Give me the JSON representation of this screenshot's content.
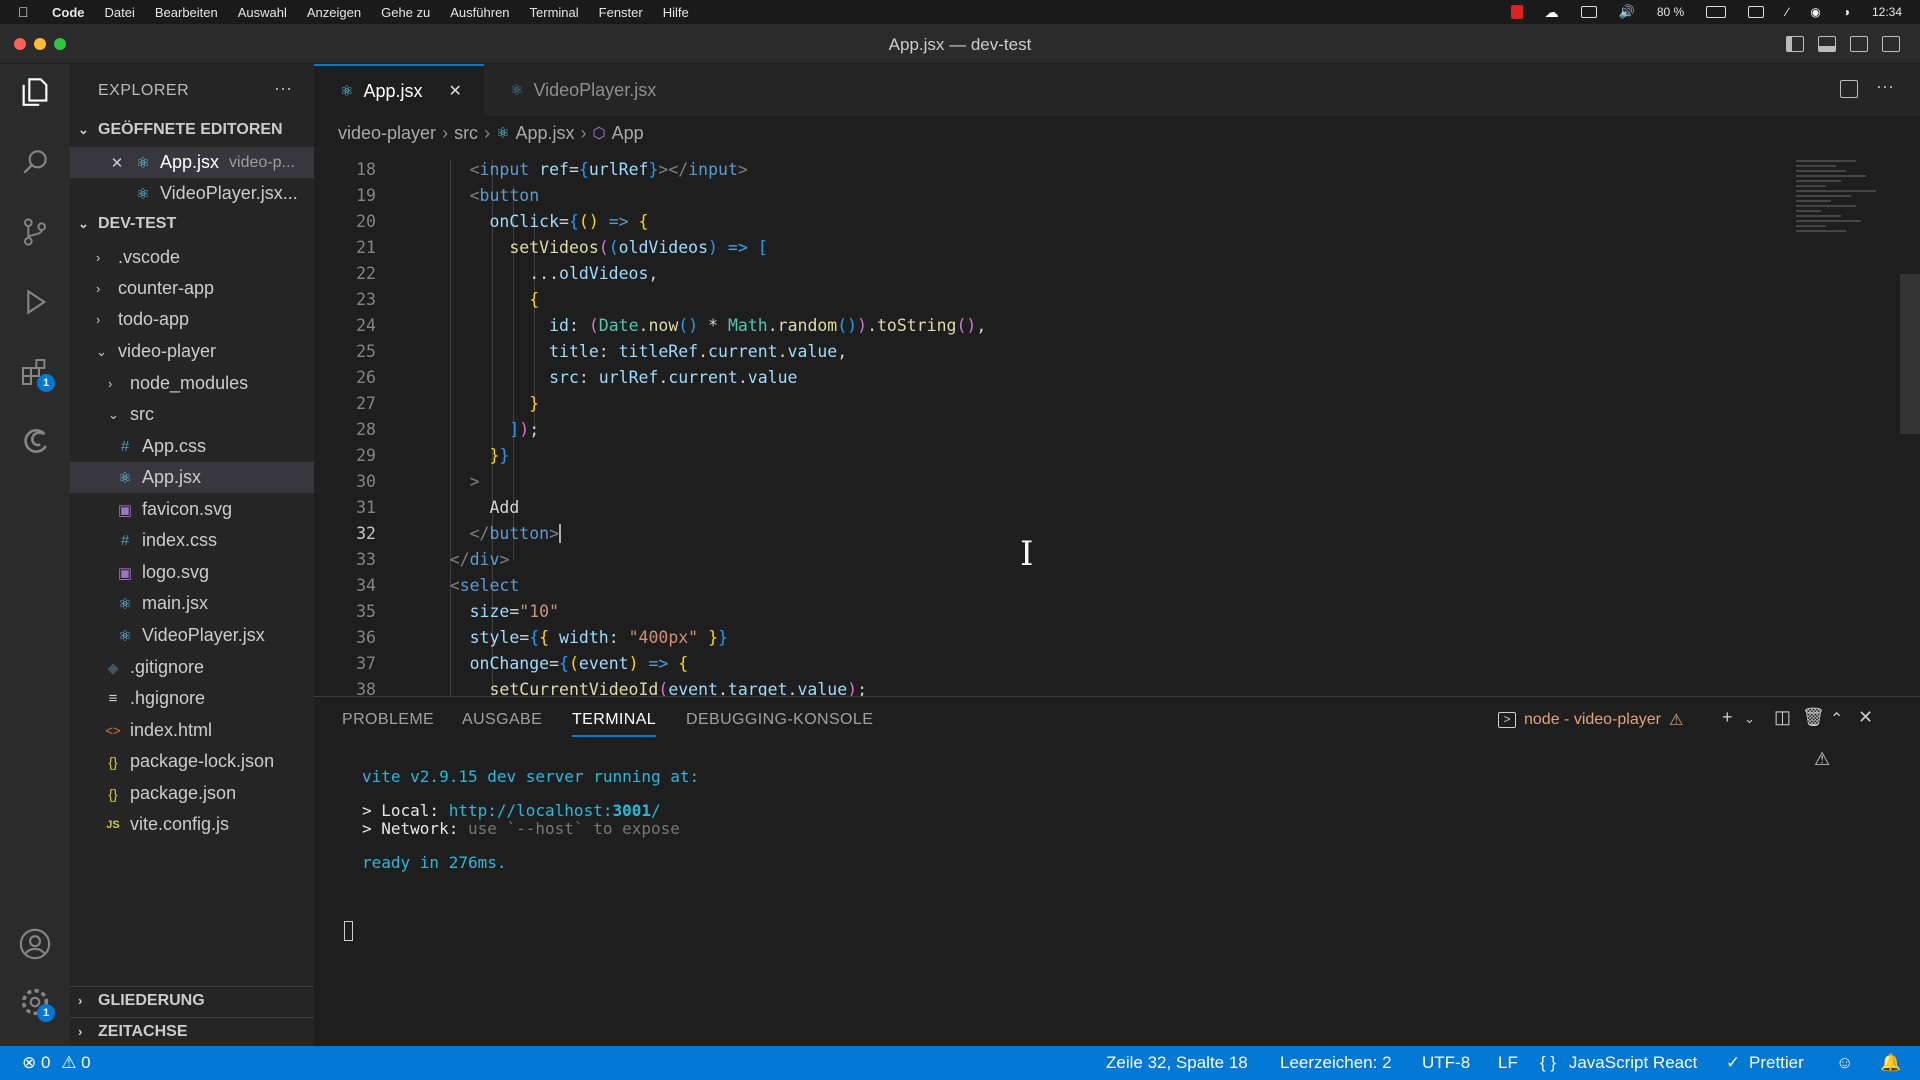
{
  "menubar": {
    "app": "Code",
    "items": [
      "Datei",
      "Bearbeiten",
      "Auswahl",
      "Anzeigen",
      "Gehe zu",
      "Ausführen",
      "Terminal",
      "Fenster",
      "Hilfe"
    ],
    "battery": "80 %",
    "time": "12:34"
  },
  "window": {
    "title": "App.jsx — dev-test"
  },
  "activitybar": {
    "extensions_badge": "1",
    "settings_badge": "1"
  },
  "sidebar": {
    "title": "EXPLORER",
    "open_editors_title": "GEÖFFNETE EDITOREN",
    "open_editors": [
      {
        "name": "App.jsx",
        "hint": "video-p..."
      },
      {
        "name": "VideoPlayer.jsx..."
      }
    ],
    "workspace_title": "DEV-TEST",
    "tree": [
      {
        "label": ".vscode"
      },
      {
        "label": "counter-app"
      },
      {
        "label": "todo-app"
      },
      {
        "label": "video-player"
      },
      {
        "label": "node_modules"
      },
      {
        "label": "src"
      },
      {
        "label": "App.css"
      },
      {
        "label": "App.jsx"
      },
      {
        "label": "favicon.svg"
      },
      {
        "label": "index.css"
      },
      {
        "label": "logo.svg"
      },
      {
        "label": "main.jsx"
      },
      {
        "label": "VideoPlayer.jsx"
      },
      {
        "label": ".gitignore"
      },
      {
        "label": ".hgignore"
      },
      {
        "label": "index.html"
      },
      {
        "label": "package-lock.json"
      },
      {
        "label": "package.json"
      },
      {
        "label": "vite.config.js"
      }
    ],
    "outline_title": "GLIEDERUNG",
    "timeline_title": "ZEITACHSE"
  },
  "editor": {
    "tabs": [
      {
        "label": "App.jsx"
      },
      {
        "label": "VideoPlayer.jsx"
      }
    ],
    "breadcrumb": [
      "video-player",
      "src",
      "App.jsx",
      "App"
    ],
    "line_numbers": [
      "18",
      "19",
      "20",
      "21",
      "22",
      "23",
      "24",
      "25",
      "26",
      "27",
      "28",
      "29",
      "30",
      "31",
      "32",
      "33",
      "34",
      "35",
      "36",
      "37",
      "38"
    ],
    "current_line": "32"
  },
  "panel": {
    "tabs": [
      "PROBLEME",
      "AUSGABE",
      "TERMINAL",
      "DEBUGGING-KONSOLE"
    ],
    "active_tab": "TERMINAL",
    "terminal_name": "node - video-player",
    "lines": {
      "server": "vite v2.9.15 dev server running at:",
      "local_label": "> Local: ",
      "local_url_prefix": "http://localhost:",
      "local_port": "3001",
      "local_url_suffix": "/",
      "network_label": "> Network: ",
      "network_hint": "use `--host` to expose",
      "ready": "ready in 276ms."
    }
  },
  "statusbar": {
    "errors": "0",
    "warnings": "0",
    "position": "Zeile 32, Spalte 18",
    "indent": "Leerzeichen: 2",
    "encoding": "UTF-8",
    "eol": "LF",
    "language": "JavaScript React",
    "formatter": "Prettier"
  }
}
